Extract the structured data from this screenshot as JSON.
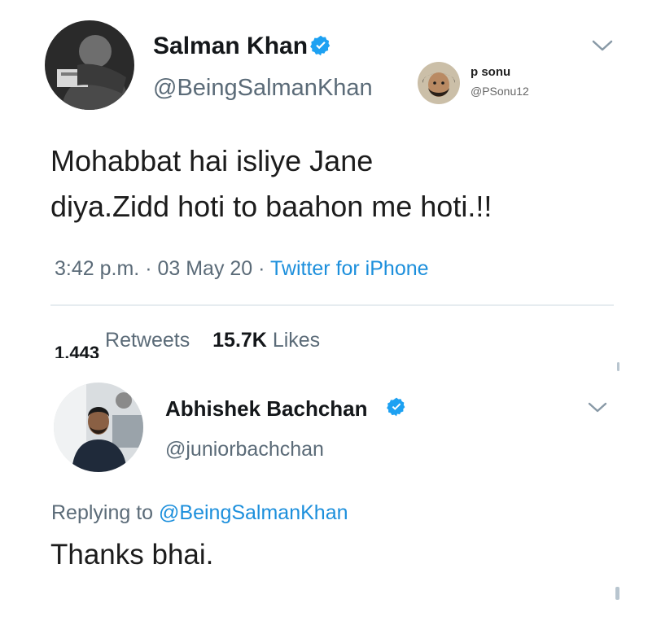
{
  "tweet": {
    "author_name": "Salman Khan",
    "author_handle": "@BeingSalmanKhan",
    "text_line1": "Mohabbat hai isliye Jane",
    "text_line2": "diya.Zidd hoti to baahon me hoti.!!",
    "time": "3:42 p.m.",
    "sep1": "·",
    "date": "03 May 20",
    "sep2": "·",
    "source": "Twitter for iPhone",
    "retweets_count": "1,443",
    "retweets_label": "Retweets",
    "likes_count": "15.7K",
    "likes_label": "Likes"
  },
  "watermark": {
    "name": "p sonu",
    "handle": "@PSonu12"
  },
  "reply": {
    "author_name": "Abhishek Bachchan",
    "author_handle": "@juniorbachchan",
    "replying_prefix": "Replying to",
    "replying_to": "@BeingSalmanKhan",
    "text": "Thanks bhai."
  },
  "icons": {
    "verified": "verified-badge-icon",
    "menu": "chevron-down-icon"
  },
  "colors": {
    "verified_blue": "#1da1f2",
    "link_blue": "#1c8fdc",
    "secondary_text": "#5b6b78"
  }
}
